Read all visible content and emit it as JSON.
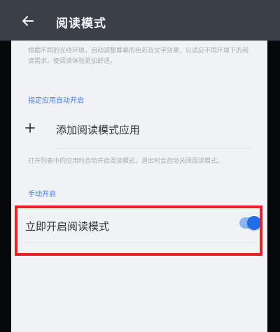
{
  "header": {
    "title": "阅读模式",
    "back_icon": "arrow-left-icon"
  },
  "main": {
    "description": "根据不同的光线环境，自动调整屏幕的色彩及文字效果，以适应不同环境下的阅读需求。使阅读体验更加舒适。",
    "auto_section_label": "指定应用自动开启",
    "add_app_label": "添加阅读模式应用",
    "add_icon": "plus-icon",
    "auto_description": "打开列表中的应用时自动开启阅读模式，退出时会自动关闭阅读模式。",
    "manual_section_label": "手动开启",
    "toggle_label": "立即开启阅读模式",
    "toggle_state": "on"
  },
  "colors": {
    "accent": "#1f6ee6",
    "highlight_border": "#ea2026",
    "topbar": "#3a3f48",
    "panel": "#f1f2f4"
  }
}
